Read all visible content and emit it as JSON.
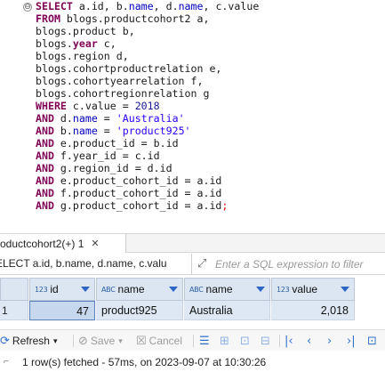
{
  "editor": {
    "lines": [
      [
        {
          "t": "SELECT",
          "c": "kw"
        },
        {
          "t": " a.id, b."
        },
        {
          "t": "name",
          "c": "fld"
        },
        {
          "t": ", d."
        },
        {
          "t": "name",
          "c": "fld"
        },
        {
          "t": ", c.value"
        }
      ],
      [
        {
          "t": "FROM",
          "c": "kw"
        },
        {
          "t": " blogs.productcohort2 a,"
        }
      ],
      [
        {
          "t": "blogs.product b,"
        }
      ],
      [
        {
          "t": "blogs."
        },
        {
          "t": "year",
          "c": "kw"
        },
        {
          "t": " c,"
        }
      ],
      [
        {
          "t": "blogs.region d,"
        }
      ],
      [
        {
          "t": "blogs.cohortproductrelation e,"
        }
      ],
      [
        {
          "t": "blogs.cohortyearrelation f,"
        }
      ],
      [
        {
          "t": "blogs.cohortregionrelation g"
        }
      ],
      [
        {
          "t": "WHERE",
          "c": "kw"
        },
        {
          "t": " c.value = "
        },
        {
          "t": "2018",
          "c": "num"
        }
      ],
      [
        {
          "t": "AND",
          "c": "kw"
        },
        {
          "t": " d."
        },
        {
          "t": "name",
          "c": "fld"
        },
        {
          "t": " = "
        },
        {
          "t": "'Australia'",
          "c": "str"
        }
      ],
      [
        {
          "t": "AND",
          "c": "kw"
        },
        {
          "t": " b."
        },
        {
          "t": "name",
          "c": "fld"
        },
        {
          "t": " = "
        },
        {
          "t": "'product925'",
          "c": "str"
        }
      ],
      [
        {
          "t": "AND",
          "c": "kw"
        },
        {
          "t": " e.product_id = b.id"
        }
      ],
      [
        {
          "t": "AND",
          "c": "kw"
        },
        {
          "t": " f.year_id = c.id"
        }
      ],
      [
        {
          "t": "AND",
          "c": "kw"
        },
        {
          "t": " g.region_id = d.id"
        }
      ],
      [
        {
          "t": "AND",
          "c": "kw"
        },
        {
          "t": " e.product_cohort_id = a.id"
        }
      ],
      [
        {
          "t": "AND",
          "c": "kw"
        },
        {
          "t": " f.product_cohort_id = a.id"
        }
      ],
      [
        {
          "t": "AND",
          "c": "kw"
        },
        {
          "t": " g.product_cohort_id = a.id"
        },
        {
          "t": ";",
          "c": "semi"
        }
      ]
    ],
    "fold_glyph": "⊖"
  },
  "results_tab": {
    "label": "roductcohort2(+) 1",
    "close_glyph": "✕"
  },
  "filter": {
    "query_text": "ELECT a.id, b.name, d.name, c.valu",
    "placeholder": "Enter a SQL expression to filter",
    "icon": "expand-icon"
  },
  "grid": {
    "columns": [
      {
        "type_badge": "123",
        "name": "id"
      },
      {
        "type_badge": "ABC",
        "name": "name"
      },
      {
        "type_badge": "ABC",
        "name": "name"
      },
      {
        "type_badge": "123",
        "name": "value"
      }
    ],
    "row_number": "1",
    "rows": [
      {
        "id": "47",
        "product": "product925",
        "region": "Australia",
        "value": "2,018"
      }
    ]
  },
  "toolbar": {
    "refresh_label": "Refresh",
    "save_label": "Save",
    "cancel_label": "Cancel",
    "colors": {
      "active": "#2f6fd1",
      "disabled": "#9c9c9c"
    }
  },
  "status": {
    "message": "1 row(s) fetched - 57ms, on 2023-09-07 at 10:30:26"
  }
}
